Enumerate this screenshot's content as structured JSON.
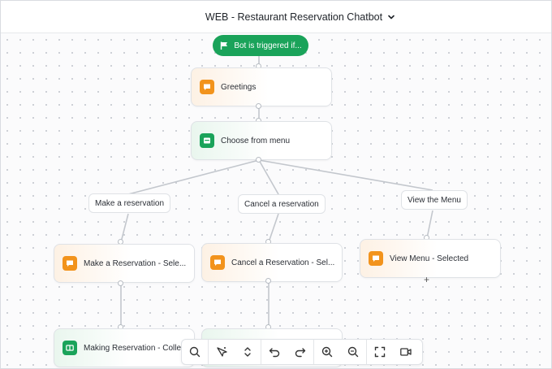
{
  "header": {
    "title": "WEB - Restaurant Reservation Chatbot",
    "dropdown_icon": "chevron-down-icon"
  },
  "flow": {
    "trigger": {
      "label": "Bot is triggered if...",
      "icon": "flag-icon"
    },
    "greetings": {
      "label": "Greetings",
      "icon": "message-icon"
    },
    "choose_menu": {
      "label": "Choose from menu",
      "icon": "menu-icon"
    },
    "branches": {
      "make_reservation": "Make a reservation",
      "cancel_reservation": "Cancel a reservation",
      "view_menu": "View the Menu"
    },
    "steps": {
      "make_selected": "Make a Reservation - Sele...",
      "cancel_selected": "Cancel a Reservation - Sel...",
      "view_selected": "View Menu - Selected",
      "making_collect": "Making Reservation - Colle..."
    },
    "add_label": "+"
  },
  "toolbar": {
    "tools": [
      "search-icon",
      "magic-select-icon",
      "expand-vertical-icon",
      "undo-icon",
      "redo-icon",
      "zoom-in-icon",
      "zoom-out-icon",
      "fullscreen-icon",
      "video-icon"
    ]
  },
  "colors": {
    "trigger_green": "#1aa35a",
    "message_orange": "#f2931c",
    "menu_green": "#1aa35a",
    "edge_gray": "#c3c7cd"
  }
}
